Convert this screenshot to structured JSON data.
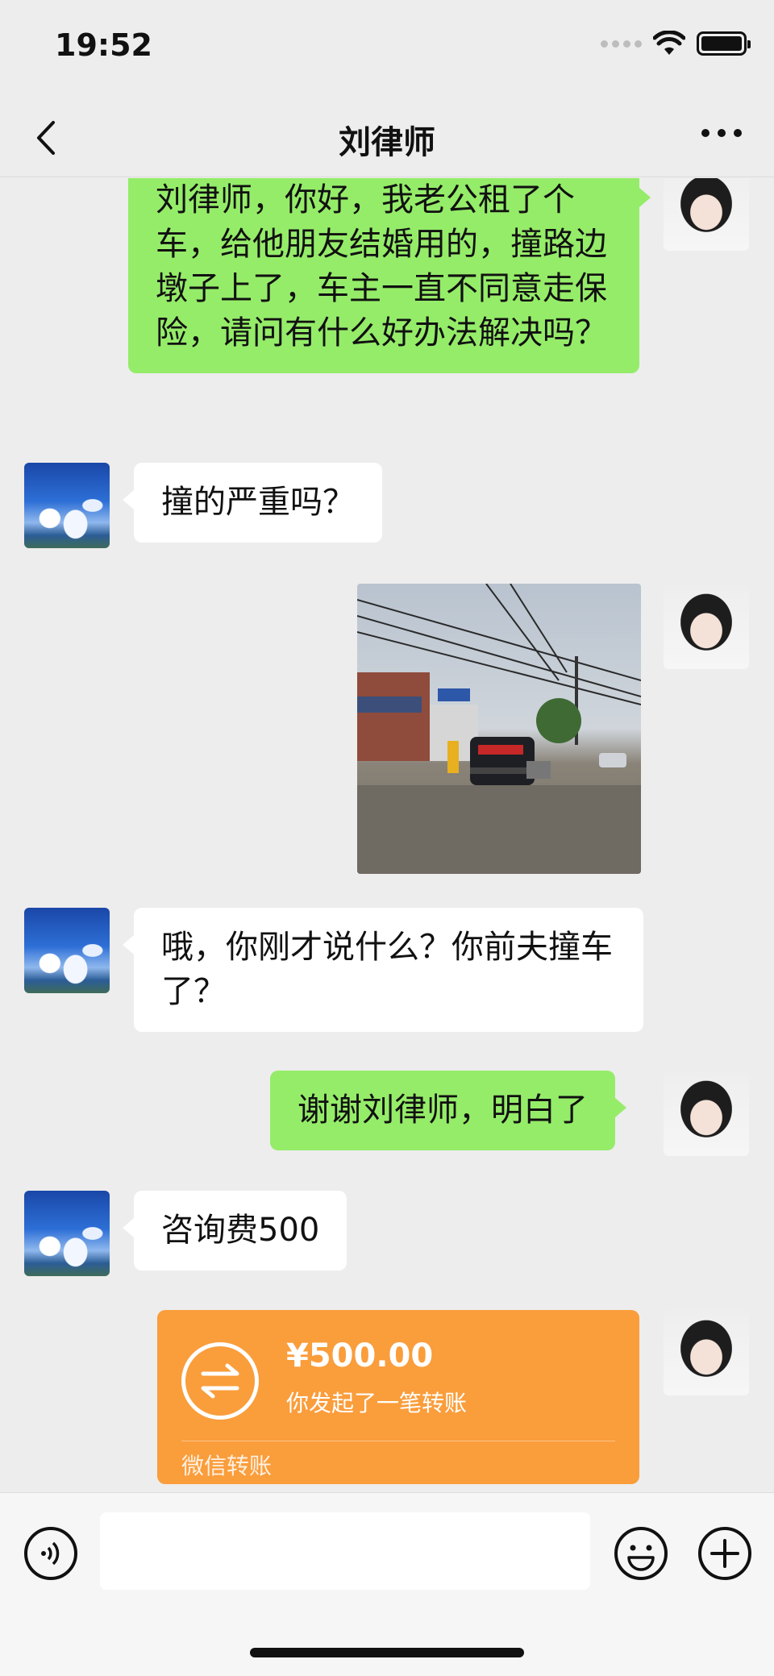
{
  "status_bar": {
    "time": "19:52"
  },
  "nav": {
    "title": "刘律师"
  },
  "messages": [
    {
      "side": "right",
      "type": "text",
      "text": "刘律师，你好，我老公租了个车，给他朋友结婚用的，撞路边墩子上了，车主一直不同意走保险，请问有什么好办法解决吗？"
    },
    {
      "side": "left",
      "type": "text",
      "text": "撞的严重吗？"
    },
    {
      "side": "right",
      "type": "image"
    },
    {
      "side": "left",
      "type": "text",
      "text": "哦，你刚才说什么？你前夫撞车了？"
    },
    {
      "side": "right",
      "type": "text",
      "text": "谢谢刘律师，明白了"
    },
    {
      "side": "left",
      "type": "text",
      "text": "咨询费500"
    },
    {
      "side": "right",
      "type": "transfer",
      "amount": "¥500.00",
      "description": "你发起了一笔转账",
      "brand": "微信转账"
    }
  ],
  "input": {
    "placeholder": ""
  },
  "icons": {
    "back": "chevron-left-icon",
    "more": "more-icon",
    "voice": "voice-icon",
    "emoji": "emoji-icon",
    "plus": "plus-icon",
    "transfer": "transfer-arrows-icon"
  },
  "colors": {
    "background": "#ededed",
    "sent_bubble": "#95ec69",
    "received_bubble": "#ffffff",
    "transfer_card": "#fa9d3b"
  }
}
